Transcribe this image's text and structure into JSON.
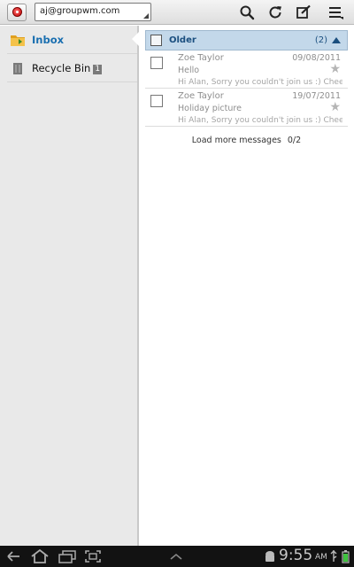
{
  "action_bar": {
    "account": "aj@groupwm.com",
    "icons": [
      "search-icon",
      "refresh-icon",
      "compose-icon",
      "menu-icon"
    ]
  },
  "folders": [
    {
      "label": "Inbox",
      "icon": "inbox-folder-icon",
      "selected": true
    },
    {
      "label": "Recycle Bin",
      "icon": "recycle-bin-icon",
      "badge": "1"
    }
  ],
  "group": {
    "title": "Older",
    "count": "(2)"
  },
  "messages": [
    {
      "from": "Zoe Taylor",
      "date": "09/08/2011",
      "subject": "Hello",
      "preview": "Hi Alan, Sorry you couldn't join us :) Cheers, Zoe",
      "starred": false
    },
    {
      "from": "Zoe Taylor",
      "date": "19/07/2011",
      "subject": "Holiday picture",
      "preview": "Hi Alan, Sorry you couldn't join us :) Cheers, Zoe",
      "starred": false
    }
  ],
  "load_more": {
    "label": "Load more messages",
    "count": "0/2"
  },
  "status_bar": {
    "time": "9:55",
    "ampm": "AM"
  },
  "colors": {
    "accent": "#1a6fb0",
    "group_header": "#c3d8ea",
    "system_bar": "#121212"
  }
}
